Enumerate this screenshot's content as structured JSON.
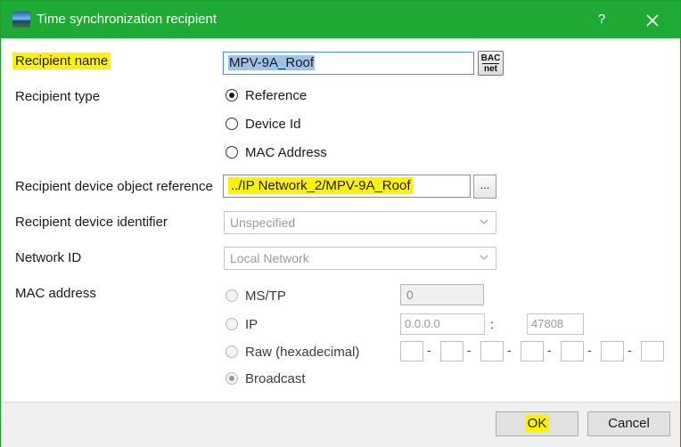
{
  "window": {
    "title": "Time synchronization recipient",
    "help_label": "?"
  },
  "labels": {
    "recipient_name": "Recipient name",
    "recipient_type": "Recipient type",
    "device_object_reference": "Recipient device object reference",
    "device_identifier": "Recipient device identifier",
    "network_id": "Network ID",
    "mac_address": "MAC address"
  },
  "fields": {
    "recipient_name_value": "MPV-9A_Roof",
    "bacnet_top": "BAC",
    "bacnet_bottom": "net",
    "device_object_reference_value": "../IP Network_2/MPV-9A_Roof",
    "browse_label": "...",
    "device_identifier_value": "Unspecified",
    "network_id_value": "Local Network"
  },
  "recipient_type_options": {
    "reference": "Reference",
    "device_id": "Device Id",
    "mac_address": "MAC Address",
    "selected": "Reference"
  },
  "mac_options": {
    "mstp": "MS/TP",
    "mstp_value": "0",
    "ip": "IP",
    "ip_address": "0.0.0.0",
    "ip_separator": ":",
    "ip_port": "47808",
    "raw": "Raw (hexadecimal)",
    "raw_separator": "-",
    "broadcast": "Broadcast",
    "selected": "Broadcast"
  },
  "buttons": {
    "ok": "OK",
    "cancel": "Cancel"
  },
  "colors": {
    "titlebar": "#1faa36",
    "highlight": "#fff200",
    "selection": "#9ec3ea"
  }
}
